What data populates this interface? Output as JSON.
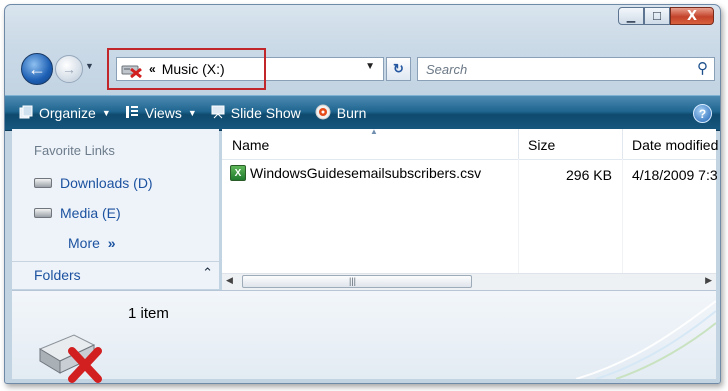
{
  "window": {
    "caption_buttons": [
      "minimize",
      "maximize",
      "close"
    ],
    "close_glyph": "X"
  },
  "navigation": {
    "address_prefix": "«",
    "address_path": "Music (X:)",
    "search_placeholder": "Search"
  },
  "toolbar": {
    "organize_label": "Organize",
    "views_label": "Views",
    "slideshow_label": "Slide Show",
    "burn_label": "Burn",
    "help_label": "?"
  },
  "favorites": {
    "title": "Favorite Links",
    "items": [
      {
        "label": "Downloads (D)"
      },
      {
        "label": "Media (E)"
      }
    ],
    "more_label": "More",
    "folders_label": "Folders"
  },
  "file_list": {
    "columns": [
      "Name",
      "Size",
      "Date modified"
    ],
    "rows": [
      {
        "name": "WindowsGuidesemailsubscribers.csv",
        "size": "296 KB",
        "date": "4/18/2009 7:3"
      }
    ]
  },
  "details_pane": {
    "item_count": "1 item"
  },
  "colors": {
    "toolbar": "#1f6690",
    "highlight_box": "#c0262a",
    "link": "#1c52a0"
  }
}
